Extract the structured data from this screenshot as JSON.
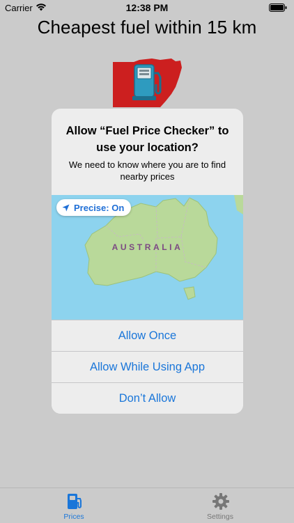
{
  "status_bar": {
    "carrier": "Carrier",
    "time": "12:38 PM"
  },
  "page": {
    "title": "Cheapest fuel within 15 km"
  },
  "permission_alert": {
    "title": "Allow “Fuel Price Checker” to use your location?",
    "message": "We need to know where you are to find nearby prices",
    "precise_label": "Precise: On",
    "map_label": "AUSTRALIA",
    "buttons": {
      "allow_once": "Allow Once",
      "allow_while_using": "Allow While Using App",
      "dont_allow": "Don’t Allow"
    }
  },
  "tab_bar": {
    "items": [
      {
        "label": "Prices",
        "icon": "fuel-pump-icon",
        "active": true
      },
      {
        "label": "Settings",
        "icon": "gear-icon",
        "active": false
      }
    ]
  },
  "colors": {
    "accent": "#1a76d9",
    "background": "#cbcbcb",
    "alert_background": "#ededed",
    "map_water": "#8dd3ee",
    "map_land": "#b9d99a",
    "logo_red": "#cc1f1f",
    "pump_teal": "#2e9bbf"
  }
}
